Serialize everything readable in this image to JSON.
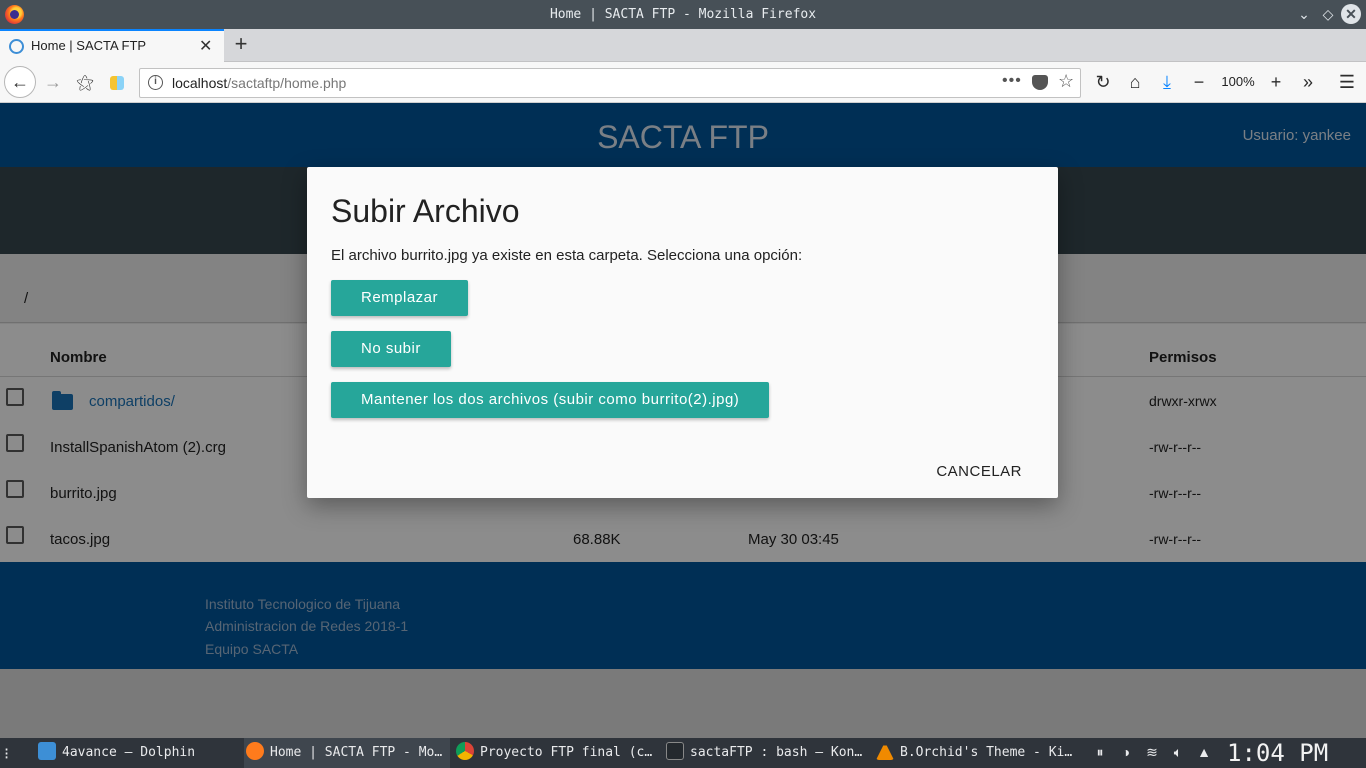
{
  "window": {
    "title": "Home | SACTA FTP - Mozilla Firefox",
    "icons": {
      "app": "firefox-icon",
      "minimize": "chevron-down-icon",
      "maximize": "diamond-icon",
      "close": "close-icon"
    }
  },
  "tab": {
    "title": "Home | SACTA FTP",
    "close": "✕",
    "new_tab": "+"
  },
  "navbar": {
    "url_host": "localhost",
    "url_path": "/sactaftp/home.php",
    "page_actions": "•••",
    "zoom": "100%"
  },
  "site": {
    "title": "SACTA FTP",
    "user": "Usuario: yankee",
    "breadcrumb": "/"
  },
  "table": {
    "headers": {
      "name": "Nombre",
      "permissions": "Permisos"
    },
    "rows": [
      {
        "name": "compartidos/",
        "size": "",
        "date": "",
        "perm": "drwxr-xrwx",
        "type": "folder"
      },
      {
        "name": "InstallSpanishAtom (2).crg",
        "size": "",
        "date": "",
        "perm": "-rw-r--r--",
        "type": "file"
      },
      {
        "name": "burrito.jpg",
        "size": "",
        "date": "",
        "perm": "-rw-r--r--",
        "type": "file"
      },
      {
        "name": "tacos.jpg",
        "size": "68.88K",
        "date": "May 30 03:45",
        "perm": "-rw-r--r--",
        "type": "file"
      }
    ]
  },
  "footer": {
    "lines": [
      "Instituto Tecnologico de Tijuana",
      "Administracion de Redes 2018-1",
      "Equipo SACTA"
    ]
  },
  "dialog": {
    "title": "Subir Archivo",
    "message": "El archivo burrito.jpg ya existe en esta carpeta. Selecciona una opción:",
    "replace": "Remplazar",
    "skip": "No subir",
    "keep_both": "Mantener los dos archivos (subir como burrito(2).jpg)",
    "cancel": "CANCELAR"
  },
  "taskbar": {
    "tasks": [
      {
        "label": "4avance — Dolphin",
        "icon": "folder-icon"
      },
      {
        "label": "Home | SACTA FTP - Mo…",
        "icon": "firefox-icon"
      },
      {
        "label": "Proyecto FTP final (c…",
        "icon": "chrome-icon"
      },
      {
        "label": "sactaFTP : bash — Kon…",
        "icon": "terminal-icon"
      },
      {
        "label": "B.Orchid's Theme - Ki…",
        "icon": "vlc-icon"
      }
    ],
    "clock": "1:04 PM"
  },
  "colors": {
    "header_blue": "#01579b",
    "subbar": "#37474f",
    "teal_button": "#26a69a",
    "link": "#1a73b8"
  }
}
